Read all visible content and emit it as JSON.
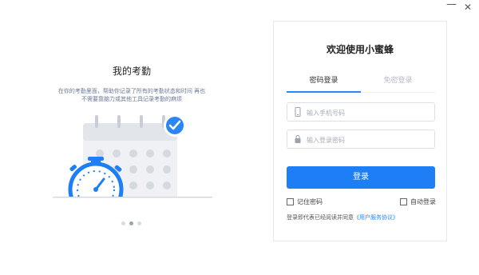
{
  "window": {
    "minimize_glyph": "—",
    "close_glyph": "✕"
  },
  "left_panel": {
    "title": "我的考勤",
    "description": "在你的考勤里面，帮助你记录了所有的考勤状态和时间 再也\n不需要靠脑力或其他工具记录考勤的麻烦",
    "carousel": {
      "count": 3,
      "active_index": 1
    }
  },
  "login": {
    "title": "欢迎使用小蜜蜂",
    "tabs": [
      {
        "label": "密码登录",
        "active": true
      },
      {
        "label": "免密登录",
        "active": false
      }
    ],
    "phone_placeholder": "输入手机号码",
    "password_placeholder": "输入登录密码",
    "login_button": "登录",
    "remember_label": "记住密码",
    "auto_login_label": "自动登录",
    "agreement_text": "登录即代表已经阅读并同意",
    "agreement_link": "《用户服务协议》"
  },
  "colors": {
    "accent": "#1e7ef5",
    "check_badge": "#2a86f5"
  },
  "icons": [
    "phone-icon",
    "lock-icon",
    "checkmark-icon",
    "stopwatch-icon",
    "calendar-icon"
  ]
}
